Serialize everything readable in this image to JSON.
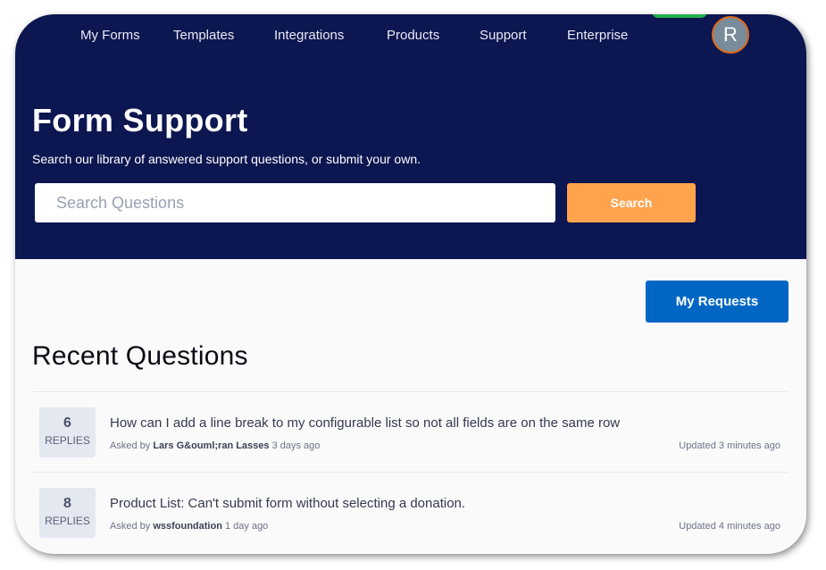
{
  "nav": {
    "items": [
      {
        "label": "My Forms"
      },
      {
        "label": "Templates"
      },
      {
        "label": "Integrations"
      },
      {
        "label": "Products"
      },
      {
        "label": "Support"
      },
      {
        "label": "Enterprise"
      }
    ],
    "avatar_initial": "R"
  },
  "hero": {
    "title": "Form Support",
    "subtitle": "Search our library of answered support questions, or submit your own.",
    "search_placeholder": "Search Questions",
    "search_value": "",
    "search_button": "Search"
  },
  "actions": {
    "my_requests": "My Requests"
  },
  "recent": {
    "title": "Recent Questions",
    "questions": [
      {
        "replies": "6",
        "replies_label": "REPLIES",
        "title": "How can I add a line break to my configurable list so not all fields are on the same row",
        "asked_prefix": "Asked by",
        "author": "Lars G&ouml;ran Lasses",
        "asked_time": "3 days ago",
        "updated": "Updated 3 minutes ago"
      },
      {
        "replies": "8",
        "replies_label": "REPLIES",
        "title": "Product List: Can't submit form without selecting a donation.",
        "asked_prefix": "Asked by",
        "author": "wssfoundation",
        "asked_time": "1 day ago",
        "updated": "Updated 4 minutes ago"
      }
    ]
  },
  "colors": {
    "hero_bg": "#0c1650",
    "search_button": "#ffa34d",
    "my_requests_button": "#0066c3",
    "avatar_ring": "#e06a1b",
    "new_badge": "#22b14c"
  }
}
